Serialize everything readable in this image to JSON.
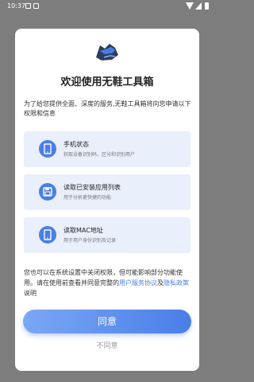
{
  "status_bar": {
    "time": "10:37"
  },
  "dialog": {
    "title": "欢迎使用无鞋工具箱",
    "intro": "为了给您提供全面、深度的服务,无鞋工具箱将向您申请以下权限和信息",
    "permissions": [
      {
        "icon": "phone-icon",
        "title": "手机状态",
        "desc": "获取设备识别码，区分和识别用户"
      },
      {
        "icon": "save-icon",
        "title": "读取已安装应用列表",
        "desc": "用于分析更快捷的功能"
      },
      {
        "icon": "phone-icon",
        "title": "读取MAC地址",
        "desc": "用于用户身份识别及记录"
      }
    ],
    "footer": {
      "text_1": "您也可以在系统设置中关闭权限，但可能影响部分功能使用。请在使用前查看并同意完整的",
      "link_user_agreement": "用户服务协议",
      "connector": "及",
      "link_privacy_policy": "隐私政策",
      "text_2": "说明"
    },
    "agree_label": "同意",
    "disagree_label": "不同意"
  },
  "colors": {
    "accent": "#4a7de8",
    "permission_bg": "#e9effb",
    "overlay": "#7d7d7d"
  }
}
